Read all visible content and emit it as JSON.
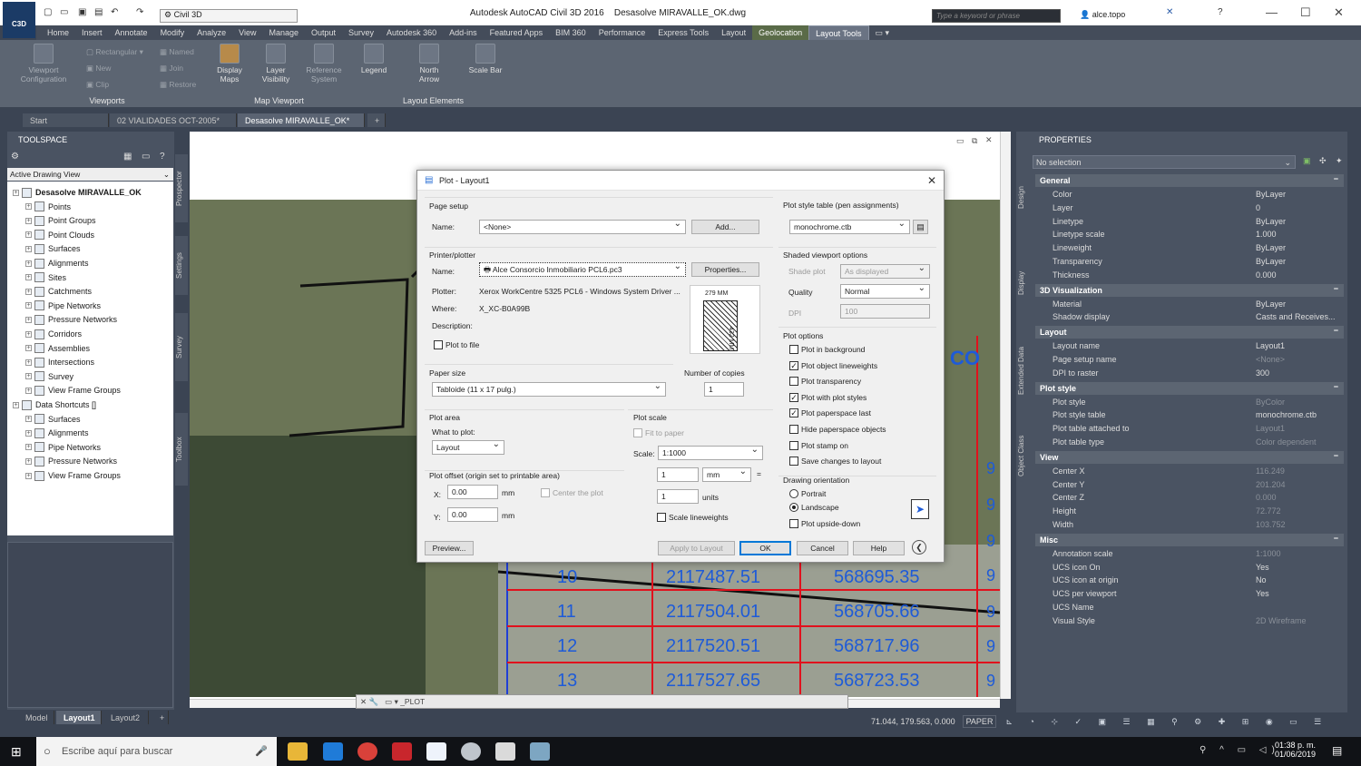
{
  "app": {
    "title": "Autodesk AutoCAD Civil 3D 2016",
    "file": "Desasolve MIRAVALLE_OK.dwg",
    "logo": "C3D",
    "workspace": "Civil 3D",
    "search_placeholder": "Type a keyword or phrase",
    "user": "alce.topo"
  },
  "ribbon_tabs": [
    "Home",
    "Insert",
    "Annotate",
    "Modify",
    "Analyze",
    "View",
    "Manage",
    "Output",
    "Survey",
    "Autodesk 360",
    "Add-ins",
    "Featured Apps",
    "BIM 360",
    "Performance",
    "Express Tools",
    "Layout",
    "Geolocation",
    "Layout Tools"
  ],
  "ribbon": {
    "viewports": {
      "label": "Viewports",
      "config": "Viewport Configuration",
      "rectangular": "Rectangular",
      "new": "New",
      "clip": "Clip",
      "named": "Named",
      "join": "Join",
      "restore": "Restore"
    },
    "map_viewport": {
      "label": "Map Viewport",
      "display_maps": "Display Maps",
      "layer_visibility": "Layer Visibility",
      "reference_system": "Reference System"
    },
    "layout_elements": {
      "label": "Layout Elements",
      "legend": "Legend",
      "north_arrow": "North Arrow",
      "scale_bar": "Scale Bar"
    }
  },
  "doc_tabs": [
    "Start",
    "02 VIALIDADES OCT-2005*",
    "Desasolve MIRAVALLE_OK*"
  ],
  "toolspace": {
    "title": "TOOLSPACE",
    "view": "Active Drawing View",
    "side_tabs": [
      "Prospector",
      "Settings",
      "Survey",
      "Toolbox"
    ],
    "root": "Desasolve MIRAVALLE_OK",
    "items": [
      "Points",
      "Point Groups",
      "Point Clouds",
      "Surfaces",
      "Alignments",
      "Sites",
      "Catchments",
      "Pipe Networks",
      "Pressure Networks",
      "Corridors",
      "Assemblies",
      "Intersections",
      "Survey",
      "View Frame Groups"
    ],
    "shortcuts_root": "Data Shortcuts []",
    "shortcuts": [
      "Surfaces",
      "Alignments",
      "Pipe Networks",
      "Pressure Networks",
      "View Frame Groups"
    ]
  },
  "map_labels": {
    "rows": [
      {
        "n": "10",
        "e": "2117487.51",
        "x": "568695.35"
      },
      {
        "n": "11",
        "e": "2117504.01",
        "x": "568705.66"
      },
      {
        "n": "12",
        "e": "2117520.51",
        "x": "568717.96"
      },
      {
        "n": "13",
        "e": "2117527.65",
        "x": "568723.53"
      }
    ],
    "right_digits": [
      "9",
      "9",
      "9",
      "9",
      "9",
      "9",
      "9"
    ],
    "corner": "CO"
  },
  "command_line": "_PLOT",
  "layout_tabs": [
    "Model",
    "Layout1",
    "Layout2"
  ],
  "status": {
    "coords": "71.044, 179.563, 0.000",
    "space": "PAPER"
  },
  "properties": {
    "title": "PROPERTIES",
    "side_tabs": [
      "Design",
      "Display",
      "Extended Data",
      "Object Class"
    ],
    "selection": "No selection",
    "sections": [
      {
        "name": "General",
        "rows": [
          {
            "k": "Color",
            "v": "ByLayer"
          },
          {
            "k": "Layer",
            "v": "0"
          },
          {
            "k": "Linetype",
            "v": "ByLayer"
          },
          {
            "k": "Linetype scale",
            "v": "1.000"
          },
          {
            "k": "Lineweight",
            "v": "ByLayer"
          },
          {
            "k": "Transparency",
            "v": "ByLayer"
          },
          {
            "k": "Thickness",
            "v": "0.000"
          }
        ]
      },
      {
        "name": "3D Visualization",
        "rows": [
          {
            "k": "Material",
            "v": "ByLayer"
          },
          {
            "k": "Shadow display",
            "v": "Casts  and  Receives..."
          }
        ]
      },
      {
        "name": "Layout",
        "rows": [
          {
            "k": "Layout name",
            "v": "Layout1"
          },
          {
            "k": "Page setup name",
            "v": "<None>",
            "dim": true
          },
          {
            "k": "DPI to raster",
            "v": "300"
          }
        ]
      },
      {
        "name": "Plot style",
        "rows": [
          {
            "k": "Plot style",
            "v": "ByColor",
            "dim": true
          },
          {
            "k": "Plot style table",
            "v": "monochrome.ctb"
          },
          {
            "k": "Plot table attached to",
            "v": "Layout1",
            "dim": true
          },
          {
            "k": "Plot table type",
            "v": "Color dependent",
            "dim": true
          }
        ]
      },
      {
        "name": "View",
        "rows": [
          {
            "k": "Center X",
            "v": "116.249",
            "dim": true
          },
          {
            "k": "Center Y",
            "v": "201.204",
            "dim": true
          },
          {
            "k": "Center Z",
            "v": "0.000",
            "dim": true
          },
          {
            "k": "Height",
            "v": "72.772",
            "dim": true
          },
          {
            "k": "Width",
            "v": "103.752",
            "dim": true
          }
        ]
      },
      {
        "name": "Misc",
        "rows": [
          {
            "k": "Annotation scale",
            "v": "1:1000",
            "dim": true
          },
          {
            "k": "UCS icon On",
            "v": "Yes"
          },
          {
            "k": "UCS icon at origin",
            "v": "No"
          },
          {
            "k": "UCS per viewport",
            "v": "Yes"
          },
          {
            "k": "UCS Name",
            "v": ""
          },
          {
            "k": "Visual Style",
            "v": "2D Wireframe",
            "dim": true
          }
        ]
      }
    ]
  },
  "dialog": {
    "title": "Plot - Layout1",
    "page_setup": {
      "label": "Page setup",
      "name_label": "Name:",
      "name": "<None>",
      "add": "Add..."
    },
    "printer": {
      "label": "Printer/plotter",
      "name_label": "Name:",
      "name": "Alce Consorcio Inmobiliario PCL6.pc3",
      "properties": "Properties...",
      "plotter_label": "Plotter:",
      "plotter": "Xerox WorkCentre 5325 PCL6 - Windows System Driver ...",
      "where_label": "Where:",
      "where": "X_XC-B0A99B",
      "description_label": "Description:",
      "plot_to_file": "Plot to file",
      "dim_w": "279  MM",
      "dim_h": "432  MM"
    },
    "paper_size": {
      "label": "Paper size",
      "value": "Tabloide (11 x 17 pulg.)"
    },
    "copies": {
      "label": "Number of copies",
      "value": "1"
    },
    "plot_area": {
      "label": "Plot area",
      "what_label": "What to plot:",
      "what": "Layout"
    },
    "plot_scale": {
      "label": "Plot scale",
      "fit": "Fit to paper",
      "scale_label": "Scale:",
      "scale": "1:1000",
      "v1": "1",
      "unit1": "mm",
      "eq": "=",
      "v2": "1",
      "unit2": "units",
      "scale_lw": "Scale lineweights"
    },
    "plot_offset": {
      "label": "Plot offset (origin set to printable area)",
      "x_label": "X:",
      "x": "0.00",
      "y_label": "Y:",
      "y": "0.00",
      "unit": "mm",
      "center": "Center the plot"
    },
    "style_table": {
      "label": "Plot style table (pen assignments)",
      "value": "monochrome.ctb"
    },
    "shaded": {
      "label": "Shaded viewport options",
      "shade_label": "Shade plot",
      "shade": "As displayed",
      "quality_label": "Quality",
      "quality": "Normal",
      "dpi_label": "DPI",
      "dpi": "100"
    },
    "options": {
      "label": "Plot options",
      "items": [
        {
          "t": "Plot in background",
          "c": false
        },
        {
          "t": "Plot object lineweights",
          "c": true
        },
        {
          "t": "Plot transparency",
          "c": false
        },
        {
          "t": "Plot with plot styles",
          "c": true
        },
        {
          "t": "Plot paperspace last",
          "c": true
        },
        {
          "t": "Hide paperspace objects",
          "c": false
        },
        {
          "t": "Plot stamp on",
          "c": false
        },
        {
          "t": "Save changes to layout",
          "c": false
        }
      ]
    },
    "orientation": {
      "label": "Drawing orientation",
      "portrait": "Portrait",
      "landscape": "Landscape",
      "upside": "Plot upside-down"
    },
    "buttons": {
      "preview": "Preview...",
      "apply": "Apply to Layout",
      "ok": "OK",
      "cancel": "Cancel",
      "help": "Help"
    }
  },
  "taskbar": {
    "search": "Escribe aquí para buscar",
    "time": "01:38 p. m.",
    "date": "01/06/2019"
  }
}
